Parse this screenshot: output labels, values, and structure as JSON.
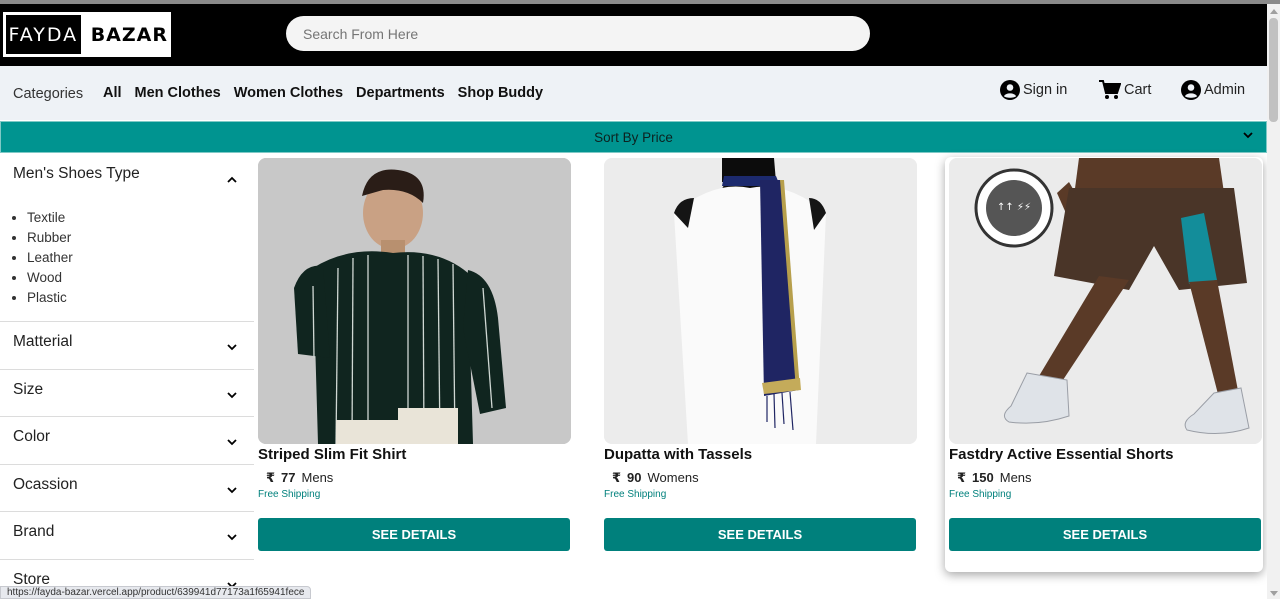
{
  "brand": {
    "left": "FAYDA",
    "right": "BAZAR"
  },
  "search": {
    "placeholder": "Search From Here"
  },
  "nav": {
    "categories": "Categories",
    "links": [
      "All",
      "Men Clothes",
      "Women Clothes",
      "Departments",
      "Shop Buddy"
    ],
    "sign_in": "Sign in",
    "cart": "Cart",
    "admin": "Admin"
  },
  "sort": {
    "label": "Sort By Price"
  },
  "sidebar": {
    "shoes_type": {
      "title": "Men's Shoes Type",
      "items": [
        "Textile",
        "Rubber",
        "Leather",
        "Wood",
        "Plastic"
      ]
    },
    "sections": [
      "Matterial",
      "Size",
      "Color",
      "Ocassion",
      "Brand",
      "Store"
    ]
  },
  "products": [
    {
      "name": "Striped Slim Fit Shirt",
      "currency": "₹",
      "price": "77",
      "category": "Mens",
      "shipping": "Free Shipping",
      "button": "SEE DETAILS"
    },
    {
      "name": "Dupatta with Tassels",
      "currency": "₹",
      "price": "90",
      "category": "Womens",
      "shipping": "Free Shipping",
      "button": "SEE DETAILS"
    },
    {
      "name": "Fastdry Active Essential Shorts",
      "currency": "₹",
      "price": "150",
      "category": "Mens",
      "shipping": "Free Shipping",
      "button": "SEE DETAILS"
    }
  ],
  "status_url": "https://fayda-bazar.vercel.app/product/639941d77173a1f65941fece",
  "colors": {
    "header": "#000000",
    "nav_bg": "#eef2f6",
    "sort_bar": "#009490",
    "button": "#00807c"
  },
  "icons": [
    "user-circle-icon",
    "cart-icon",
    "chevron-down-icon",
    "chevron-up-icon"
  ]
}
